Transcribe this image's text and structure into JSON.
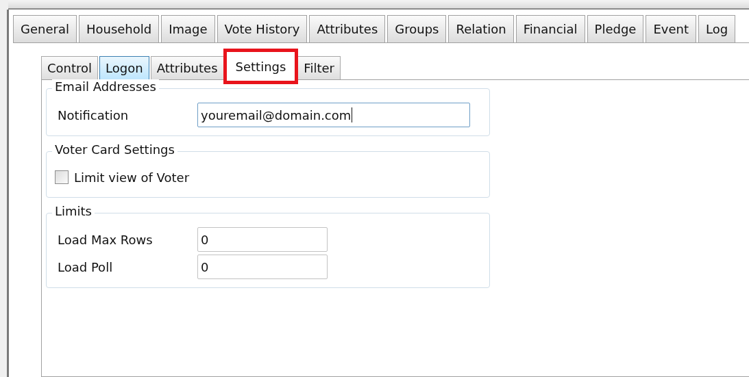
{
  "tabs": [
    {
      "label": "General",
      "selected": false
    },
    {
      "label": "Household",
      "selected": false
    },
    {
      "label": "Image",
      "selected": false
    },
    {
      "label": "Vote History",
      "selected": false
    },
    {
      "label": "Attributes",
      "selected": false
    },
    {
      "label": "Groups",
      "selected": false
    },
    {
      "label": "Relation",
      "selected": false
    },
    {
      "label": "Financial",
      "selected": false
    },
    {
      "label": "Pledge",
      "selected": false
    },
    {
      "label": "Event",
      "selected": false
    },
    {
      "label": "Log",
      "selected": false
    }
  ],
  "sub_tabs": [
    {
      "label": "Control",
      "selected": false,
      "hovered": false,
      "highlighted": false
    },
    {
      "label": "Logon",
      "selected": false,
      "hovered": true,
      "highlighted": false
    },
    {
      "label": "Attributes",
      "selected": false,
      "hovered": false,
      "highlighted": false
    },
    {
      "label": "Settings",
      "selected": true,
      "hovered": false,
      "highlighted": true
    },
    {
      "label": "Filter",
      "selected": false,
      "hovered": false,
      "highlighted": false
    }
  ],
  "groups": [
    {
      "title": "Email Addresses",
      "rows": [
        {
          "kind": "field",
          "label": "Notification",
          "value": "youremail@domain.com",
          "wide": true,
          "focused": true
        }
      ]
    },
    {
      "title": "Voter Card Settings",
      "rows": [
        {
          "kind": "checkbox",
          "label": "Limit view of Voter",
          "checked": false
        }
      ]
    },
    {
      "title": "Limits",
      "rows": [
        {
          "kind": "field",
          "label": "Load Max Rows",
          "value": "0",
          "wide": false,
          "focused": false
        },
        {
          "kind": "field",
          "label": "Load Poll",
          "value": "0",
          "wide": false,
          "focused": false
        }
      ]
    }
  ]
}
